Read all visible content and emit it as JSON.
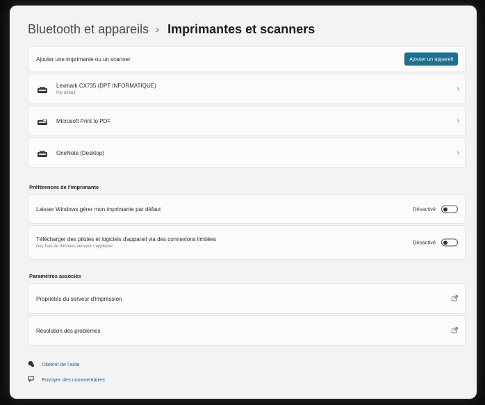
{
  "breadcrumb": {
    "parent": "Bluetooth et appareils",
    "separator": "›",
    "current": "Imprimantes et scanners"
  },
  "add_row": {
    "label": "Ajouter une imprimante ou un scanner",
    "button_label": "Ajouter un appareil"
  },
  "printers": [
    {
      "name": "Lexmark CX735 (DPT INFORMATIQUE)",
      "sub": "Par défaut",
      "icon": "printer-icon"
    },
    {
      "name": "Microsoft Print to PDF",
      "sub": "",
      "icon": "printer-pdf-icon"
    },
    {
      "name": "OneNote (Desktop)",
      "sub": "",
      "icon": "printer-icon"
    }
  ],
  "chevron": "›",
  "prefs": {
    "title": "Préférences de l'imprimante",
    "items": [
      {
        "label": "Laisser Windows gérer mon imprimante par défaut",
        "sub": "",
        "state": "Désactivé",
        "on": false
      },
      {
        "label": "Télécharger des pilotes et logiciels d'appareil via des connexions limitées",
        "sub": "Des frais de données peuvent s'appliquer.",
        "state": "Désactivé",
        "on": false
      }
    ]
  },
  "related": {
    "title": "Paramètres associés",
    "items": [
      {
        "label": "Propriétés du serveur d'impression",
        "icon": "external-link-icon"
      },
      {
        "label": "Résolution des problèmes",
        "icon": "external-link-icon"
      }
    ]
  },
  "footer": {
    "help": "Obtenir de l'aide",
    "feedback": "Envoyer des commentaires"
  },
  "colors": {
    "accent": "#1f6f8f",
    "background": "#f3f3f3",
    "card": "#fbfbfb"
  }
}
